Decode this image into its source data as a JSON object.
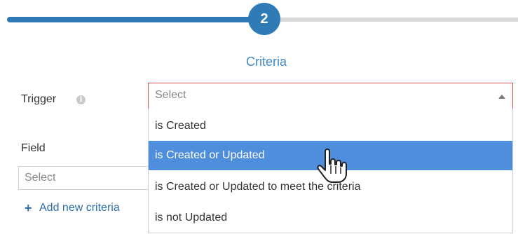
{
  "stepper": {
    "step_number": "2",
    "step_title": "Criteria"
  },
  "trigger": {
    "label": "Trigger",
    "info_icon": "info-icon",
    "placeholder": "Select",
    "options": [
      "is Created",
      "is Created or Updated",
      "is Created or Updated to meet the criteria",
      "is not Updated"
    ],
    "highlighted_option": "is Created or Updated"
  },
  "field": {
    "label": "Field",
    "placeholder": "Select"
  },
  "add_criteria": {
    "icon": "plus-icon",
    "label": "Add new criteria"
  },
  "colors": {
    "accent": "#2e7bb6",
    "highlight": "#4f8edc",
    "error_border": "#d9534f"
  }
}
